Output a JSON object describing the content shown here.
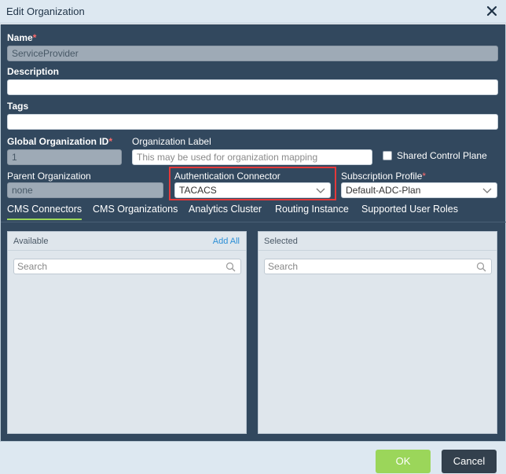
{
  "dialog": {
    "title": "Edit Organization"
  },
  "form": {
    "name": {
      "label": "Name",
      "required_mark": "*",
      "value": "ServiceProvider"
    },
    "description": {
      "label": "Description",
      "value": ""
    },
    "tags": {
      "label": "Tags",
      "value": ""
    },
    "global_org_id": {
      "label": "Global Organization ID",
      "required_mark": "*",
      "value": "1"
    },
    "org_label": {
      "label": "Organization Label",
      "placeholder": "This may be used for organization mapping"
    },
    "shared_control_plane": {
      "label": "Shared Control Plane",
      "checked": false
    },
    "parent_org": {
      "label": "Parent Organization",
      "value": "none"
    },
    "auth_connector": {
      "label": "Authentication Connector",
      "value": "TACACS"
    },
    "subscription_profile": {
      "label": "Subscription Profile",
      "required_mark": "*",
      "value": "Default-ADC-Plan"
    }
  },
  "tabs": [
    {
      "label": "CMS Connectors",
      "active": true
    },
    {
      "label": "CMS Organizations",
      "active": false
    },
    {
      "label": "Analytics Cluster",
      "active": false
    },
    {
      "label": "Routing Instance",
      "active": false
    },
    {
      "label": "Supported User Roles",
      "active": false
    }
  ],
  "available": {
    "title": "Available",
    "add_all": "Add All",
    "search_placeholder": "Search"
  },
  "selected": {
    "title": "Selected",
    "search_placeholder": "Search"
  },
  "footer": {
    "ok_label": "OK",
    "cancel_label": "Cancel"
  },
  "colors": {
    "panel": "#32485e",
    "accent": "#9bd65a",
    "highlight": "#e5393a",
    "link": "#2c8fd6"
  }
}
